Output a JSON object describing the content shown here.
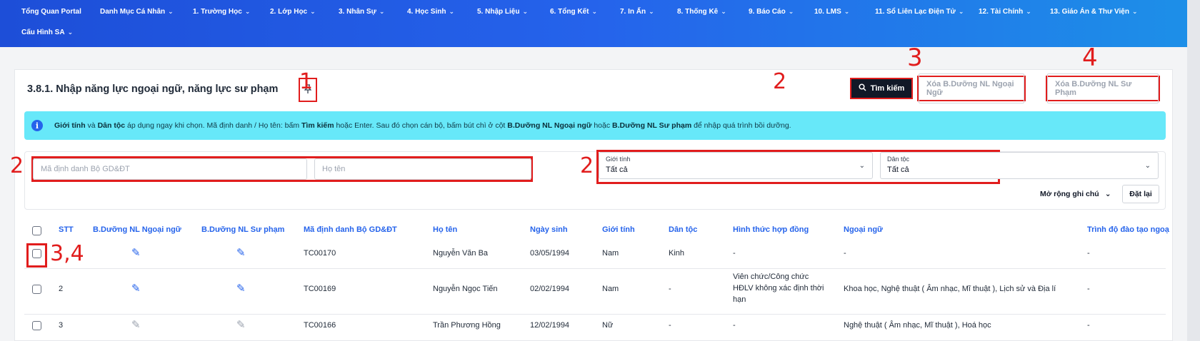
{
  "nav": {
    "row1": [
      {
        "label": "Tổng Quan Portal",
        "chevron": false
      },
      {
        "label": "Danh Mục Cá Nhân",
        "chevron": true
      },
      {
        "label": "1. Trường Học",
        "chevron": true
      },
      {
        "label": "2. Lớp Học",
        "chevron": true
      },
      {
        "label": "3. Nhân Sự",
        "chevron": true
      },
      {
        "label": "4. Học Sinh",
        "chevron": true
      },
      {
        "label": "5. Nhập Liệu",
        "chevron": true
      },
      {
        "label": "6. Tổng Kết",
        "chevron": true
      },
      {
        "label": "7. In Ấn",
        "chevron": true
      },
      {
        "label": "8. Thống Kê",
        "chevron": true
      },
      {
        "label": "9. Báo Cáo",
        "chevron": true
      },
      {
        "label": "10. LMS",
        "chevron": true
      },
      {
        "label": "11. Sổ Liên Lạc Điện Tử",
        "chevron": true
      },
      {
        "label": "12. Tài Chính",
        "chevron": true
      },
      {
        "label": "13. Giáo Án & Thư Viện",
        "chevron": true
      }
    ],
    "row2": [
      {
        "label": "Cấu Hình SA",
        "chevron": true
      }
    ]
  },
  "page": {
    "title": "3.8.1. Nhập năng lực ngoại ngữ, năng lực sư phạm",
    "pin_icon": "pin-icon"
  },
  "toolbar": {
    "search_label": "Tìm kiếm",
    "clear_foreign_label": "Xóa B.Dưỡng NL Ngoại Ngữ",
    "clear_pedagogy_label": "Xóa B.Dưỡng NL Sư Phạm"
  },
  "annotations": {
    "a1": "1",
    "a2_search": "2",
    "a3": "3",
    "a4": "4",
    "a2_left": "2",
    "a2_mid": "2",
    "a34": "3,4"
  },
  "info": {
    "p1": "Giới tính",
    "p2": " và ",
    "p3": "Dân tộc",
    "p4": " áp dụng ngay khi chọn. Mã định danh / Họ tên: bấm ",
    "p5": "Tìm kiếm",
    "p6": " hoặc Enter. Sau đó chọn cán bộ, bấm bút chì ở cột ",
    "p7": "B.Dưỡng NL Ngoại ngữ",
    "p8": " hoặc ",
    "p9": "B.Dưỡng NL Sư phạm",
    "p10": " để nhập quá trình bồi dưỡng."
  },
  "filters": {
    "id_placeholder": "Mã định danh Bộ GD&ĐT",
    "name_placeholder": "Họ tên",
    "gender_label": "Giới tính",
    "gender_value": "Tất cả",
    "ethnic_label": "Dân tộc",
    "ethnic_value": "Tất cả",
    "expand_notes": "Mở rộng ghi chú",
    "reset_label": "Đặt lại"
  },
  "table": {
    "headers": [
      "STT",
      "B.Dưỡng NL Ngoại ngữ",
      "B.Dưỡng NL Sư phạm",
      "Mã định danh Bộ GD&ĐT",
      "Họ tên",
      "Ngày sinh",
      "Giới tính",
      "Dân tộc",
      "Hình thức hợp đồng",
      "Ngoại ngữ",
      "Trình độ đào tạo ngoạ"
    ],
    "rows": [
      {
        "stt": "",
        "editable": true,
        "id": "TC00170",
        "name": "Nguyễn Văn Ba",
        "dob": "03/05/1994",
        "gender": "Nam",
        "ethnic": "Kinh",
        "contract": "-",
        "language": "-",
        "training": "-"
      },
      {
        "stt": "2",
        "editable": true,
        "id": "TC00169",
        "name": "Nguyễn Ngọc Tiến",
        "dob": "02/02/1994",
        "gender": "Nam",
        "ethnic": "-",
        "contract": "Viên chức/Công chức HĐLV không xác định thời hạn",
        "language": "Khoa học, Nghệ thuật ( Âm nhạc, Mĩ thuật ), Lịch sử và Địa lí",
        "training": "-"
      },
      {
        "stt": "3",
        "editable": false,
        "id": "TC00166",
        "name": "Trần Phương Hồng",
        "dob": "12/02/1994",
        "gender": "Nữ",
        "ethnic": "-",
        "contract": "-",
        "language": "Nghệ thuật ( Âm nhạc, Mĩ thuật ), Hoá học",
        "training": "-"
      }
    ]
  },
  "colors": {
    "nav": "#2563eb",
    "accent": "#2563eb",
    "info": "#67e8f9",
    "annotation": "#e11d1d"
  }
}
